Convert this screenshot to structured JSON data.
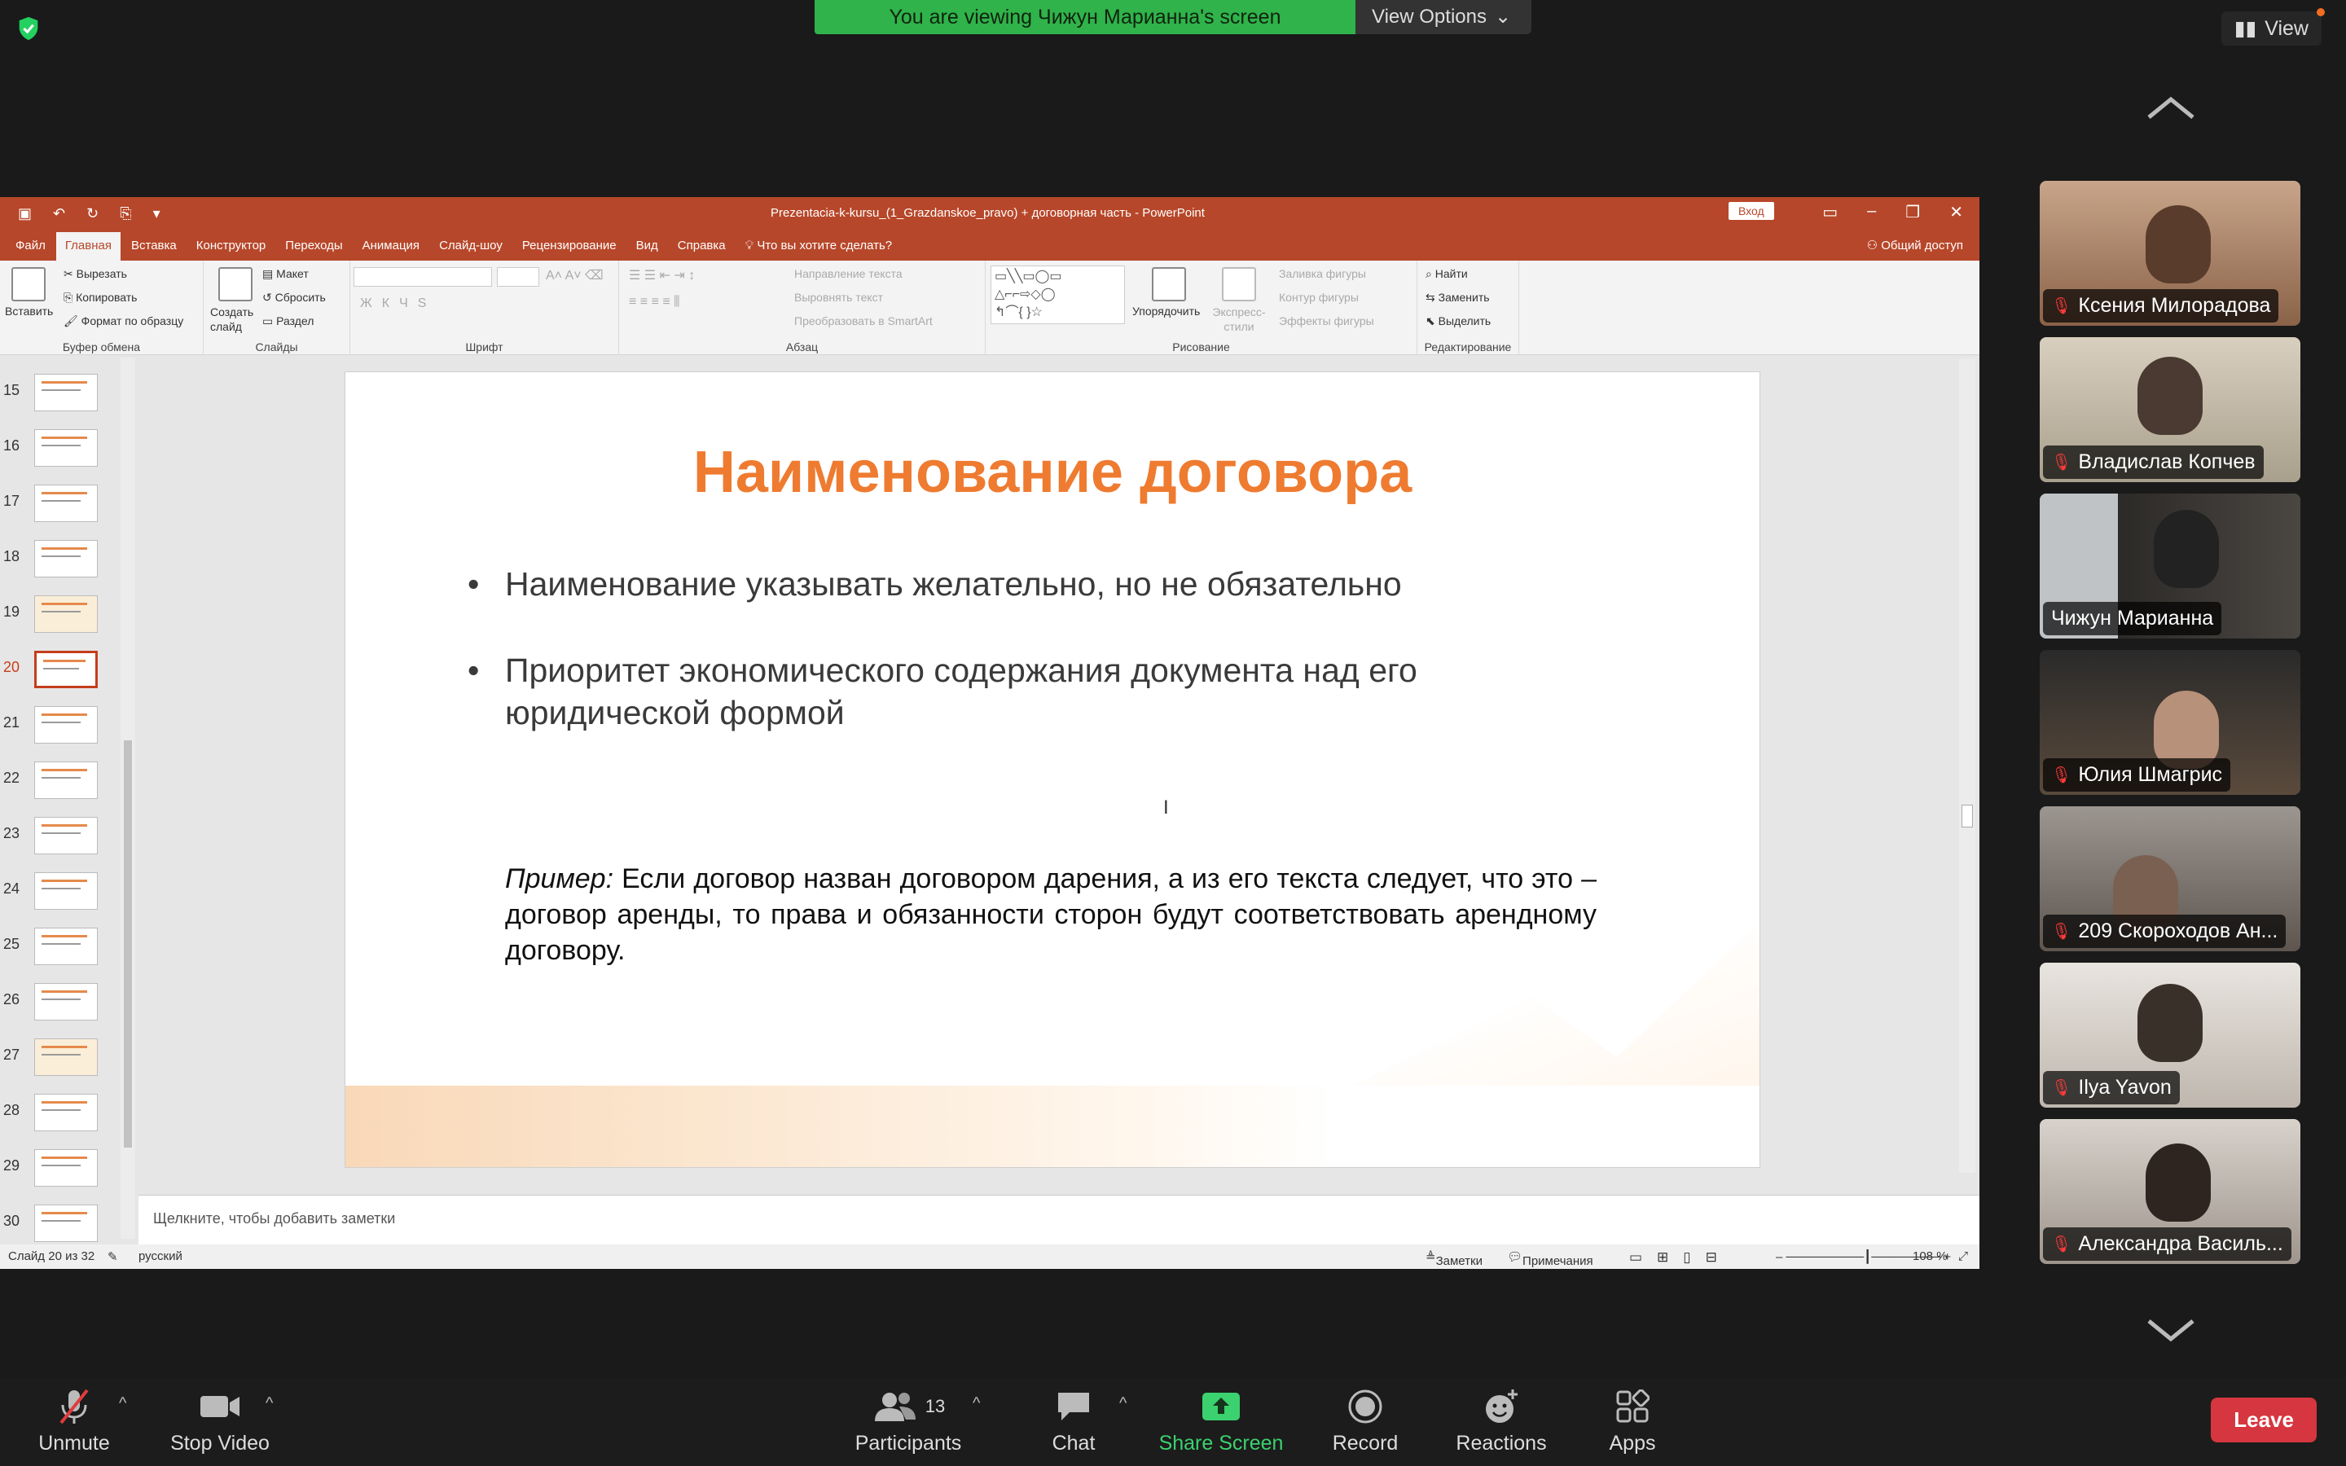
{
  "zoom": {
    "banner": "You are viewing Чижун Марианна's screen",
    "view_options": "View Options",
    "view": "View",
    "toolbar": {
      "unmute": "Unmute",
      "stop_video": "Stop Video",
      "participants": "Participants",
      "participants_count": "13",
      "chat": "Chat",
      "share_screen": "Share Screen",
      "record": "Record",
      "reactions": "Reactions",
      "apps": "Apps",
      "leave": "Leave"
    },
    "participants": [
      {
        "name": "Ксения Милорадова",
        "muted": true
      },
      {
        "name": "Владислав Копчев",
        "muted": true
      },
      {
        "name": "Чижун Марианна",
        "muted": false,
        "active": true
      },
      {
        "name": "Юлия Шмагрис",
        "muted": true
      },
      {
        "name": "209 Скороходов Ан...",
        "muted": true
      },
      {
        "name": "Ilya Yavon",
        "muted": true
      },
      {
        "name": "Александра Василь...",
        "muted": true
      }
    ]
  },
  "pp": {
    "doc_title": "Prezentacia-k-kursu_(1_Grazdanskoe_pravo) + договорная часть  -  PowerPoint",
    "login": "Вход",
    "tabs": [
      "Файл",
      "Главная",
      "Вставка",
      "Конструктор",
      "Переходы",
      "Анимация",
      "Слайд-шоу",
      "Рецензирование",
      "Вид",
      "Справка"
    ],
    "tell_me": "Что вы хотите сделать?",
    "share": "Общий доступ",
    "ribbon": {
      "paste": "Вставить",
      "cut": "Вырезать",
      "copy": "Копировать",
      "format_painter": "Формат по образцу",
      "clipboard": "Буфер обмена",
      "new_slide": "Создать слайд",
      "layout": "Макет",
      "reset": "Сбросить",
      "section": "Раздел",
      "slides": "Слайды",
      "font": "Шрифт",
      "text_direction": "Направление текста",
      "align_text": "Выровнять текст",
      "smartart": "Преобразовать в SmartArt",
      "paragraph": "Абзац",
      "arrange": "Упорядочить",
      "quick_styles": "Экспресс-стили",
      "shape_fill": "Заливка фигуры",
      "shape_outline": "Контур фигуры",
      "shape_effects": "Эффекты фигуры",
      "drawing": "Рисование",
      "find": "Найти",
      "replace": "Заменить",
      "select": "Выделить",
      "editing": "Редактирование"
    },
    "slide_numbers": [
      "15",
      "16",
      "17",
      "18",
      "19",
      "20",
      "21",
      "22",
      "23",
      "24",
      "25",
      "26",
      "27",
      "28",
      "29",
      "30"
    ],
    "active_slide": "20",
    "slide": {
      "title": "Наименование договора",
      "bullets": [
        "Наименование указывать желательно, но не обязательно",
        "Приоритет экономического содержания документа над его юридической формой"
      ],
      "example_label": "Пример:",
      "example_text": " Если договор назван договором дарения, а из его текста следует, что это – договор аренды, то права и обязанности сторон будут соответствовать арендному договору."
    },
    "notes_placeholder": "Щелкните, чтобы добавить заметки",
    "status": {
      "slide_of": "Слайд 20 из 32",
      "language": "русский",
      "notes": "Заметки",
      "comments": "Примечания",
      "zoom": "108 %"
    }
  },
  "colors": {
    "ppt_red": "#b7472a",
    "title_orange": "#ee7b30",
    "zoom_green": "#2fb34a",
    "leave_red": "#d6363f"
  }
}
